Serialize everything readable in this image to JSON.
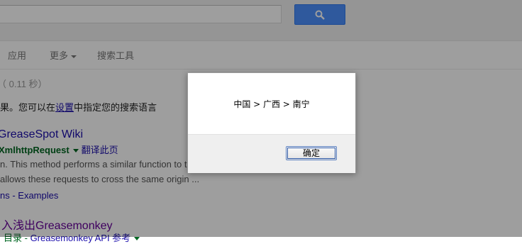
{
  "tabs": {
    "apps": "应用",
    "more": "更多",
    "tools": "搜索工具"
  },
  "stats": "（ 0.11 秒）",
  "lang_note": {
    "before": "果。您可以在",
    "link": "设置",
    "after": "中指定您的搜索语言"
  },
  "result1": {
    "title": "GreaseSpot Wiki",
    "url": "XmlhttpRequest",
    "translate": "翻译此页",
    "snippet1": "n. This method performs a similar function to t",
    "snippet2": " allows these requests to cross the same origin ...",
    "sitelinks": "ns - Examples"
  },
  "result2": {
    "title": "入浅出Greasemonkey",
    "url_prefix": "目录 - ",
    "url_link": "Greasemonkey API 参考"
  },
  "dialog": {
    "message": "中国 > 广西 > 南宁",
    "ok_label": "确定"
  }
}
